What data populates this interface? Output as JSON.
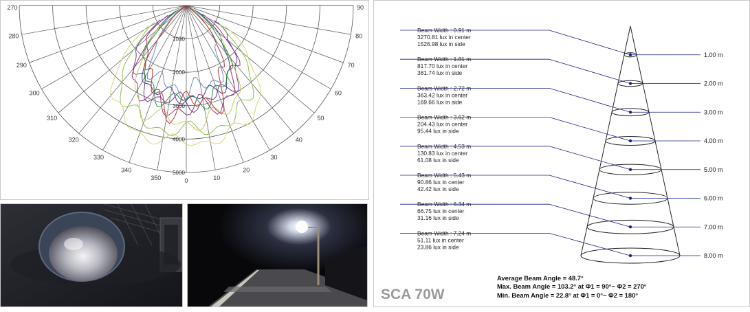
{
  "polar": {
    "angle_labels": [
      "270",
      "280",
      "290",
      "300",
      "310",
      "320",
      "330",
      "340",
      "350",
      "0",
      "10",
      "20",
      "30",
      "40",
      "50",
      "60",
      "70",
      "80",
      "90"
    ],
    "ring_labels": [
      "1000",
      "2000",
      "3000",
      "4000",
      "5000"
    ],
    "curve_colors": [
      "#6c3a96",
      "#3a3f9a",
      "#9c2f7f",
      "#8fbf4b",
      "#d8d67a",
      "#c7c86a",
      "#6c8cc8",
      "#c0392b",
      "#2b8a3e"
    ]
  },
  "cone": {
    "rows": [
      {
        "beam_width": "Beam Width : 0.91 m",
        "center": "3270.81 lux in center",
        "side": "1526.98 lux in side",
        "distance": "1.00 m"
      },
      {
        "beam_width": "Beam Width : 1.81 m",
        "center": "817.70 lux in center",
        "side": "381.74 lux in side",
        "distance": "2.00 m"
      },
      {
        "beam_width": "Beam Width : 2.72 m",
        "center": "363.42 lux in center",
        "side": "169.66 lux in side",
        "distance": "3.00 m"
      },
      {
        "beam_width": "Beam Width : 3.62 m",
        "center": "204.43 lux in center",
        "side": "95.44 lux in side",
        "distance": "4.00 m"
      },
      {
        "beam_width": "Beam Width : 4.53 m",
        "center": "130.83 lux in center",
        "side": "61.08 lux in side",
        "distance": "5.00 m"
      },
      {
        "beam_width": "Beam Width : 5.43 m",
        "center": "90.86 lux in center",
        "side": "42.42 lux in side",
        "distance": "6.00 m"
      },
      {
        "beam_width": "Beam Width : 6.34 m",
        "center": "66.75 lux in center",
        "side": "31.16 lux in side",
        "distance": "7.00 m"
      },
      {
        "beam_width": "Beam Width : 7.24 m",
        "center": "51.11 lux in center",
        "side": "23.86 lux in side",
        "distance": "8.00 m"
      }
    ],
    "average_beam_angle": "Average Beam Angle = 48.7°",
    "max_beam_angle": "Max. Beam Angle = 103.2° at Φ1 = 90°~ Φ2 = 270°",
    "min_beam_angle": "Min. Beam Angle = 22.8° at Φ1 = 0°~ Φ2 = 180°",
    "product_title": "SCA 70W"
  }
}
